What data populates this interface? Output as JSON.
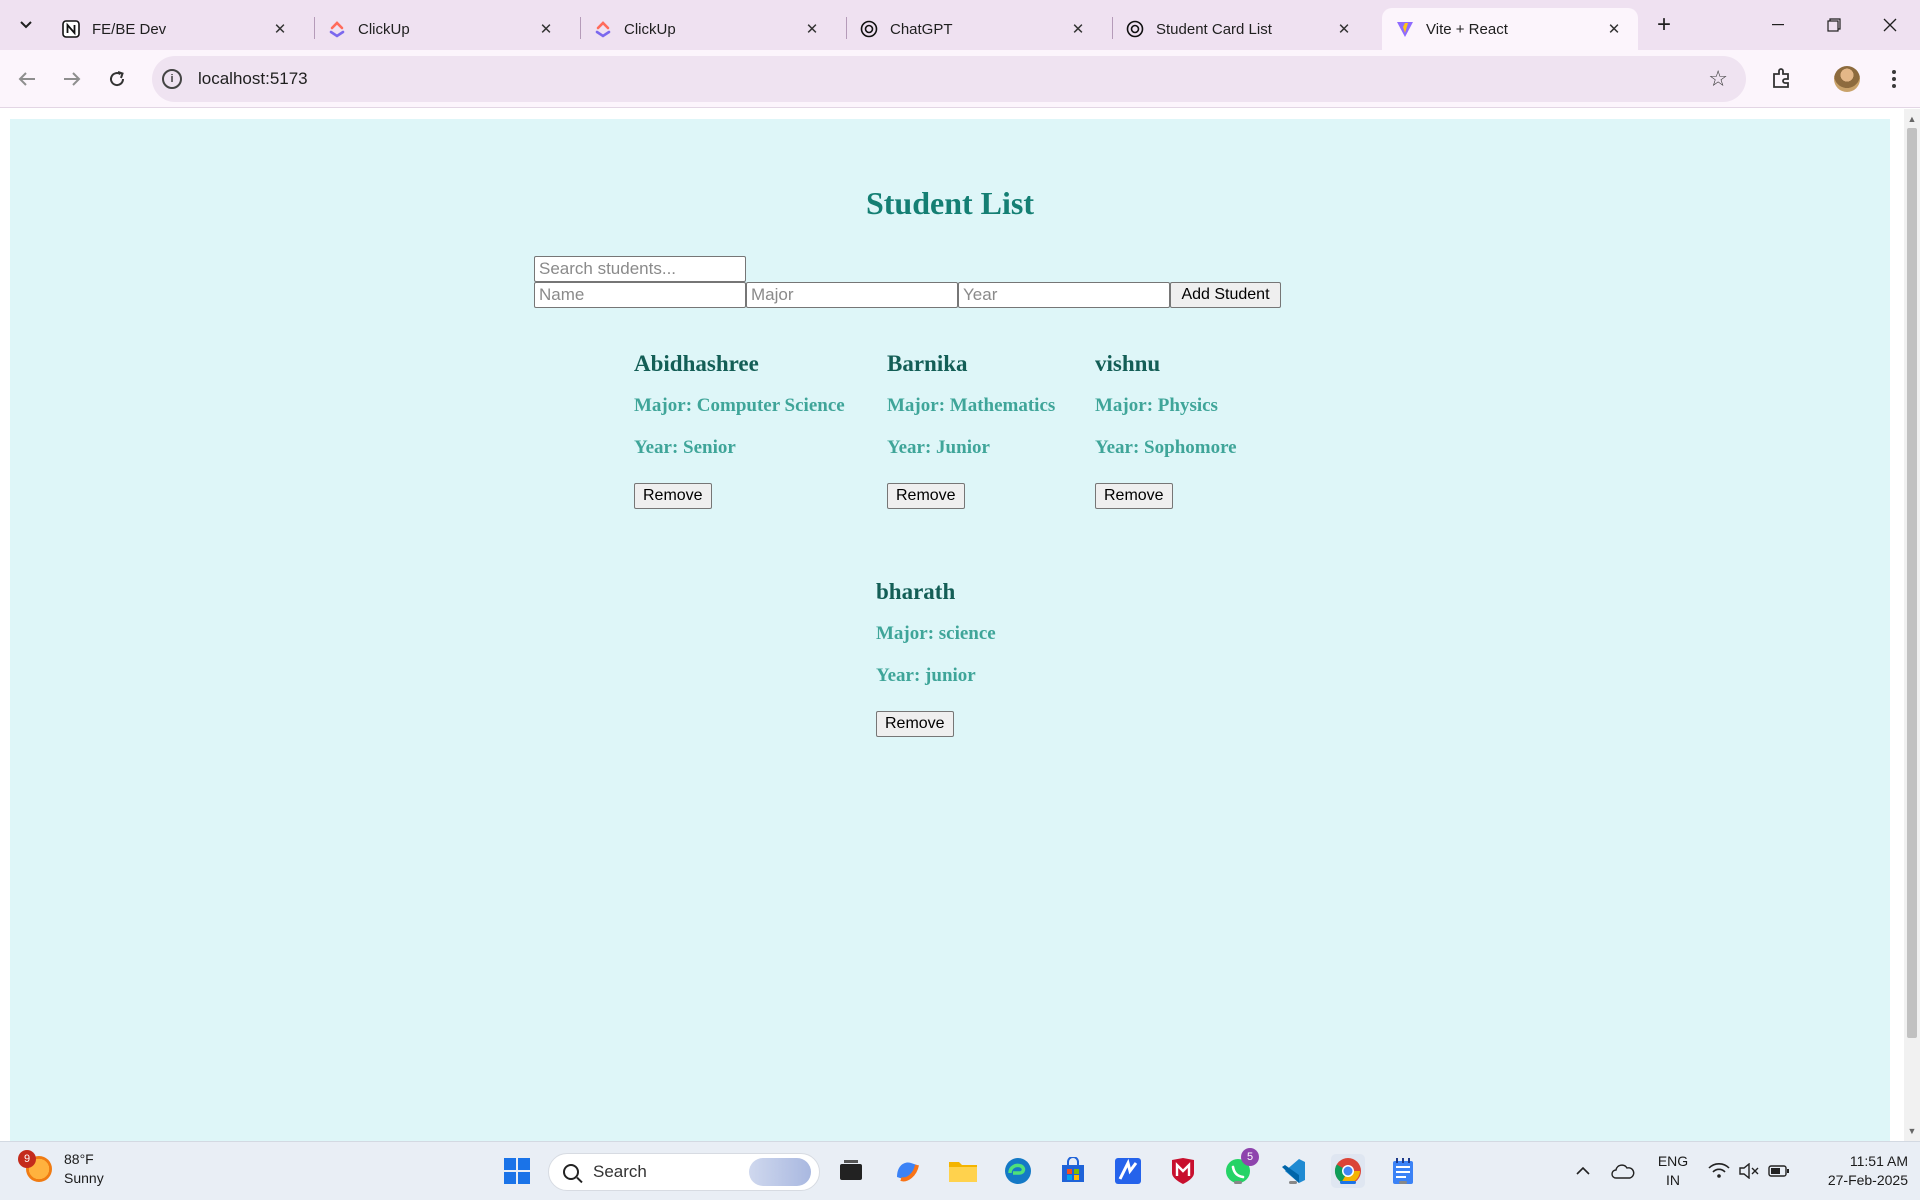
{
  "browser": {
    "tabs": [
      {
        "title": "FE/BE Dev",
        "favicon": "notion-icon"
      },
      {
        "title": "ClickUp",
        "favicon": "clickup-icon"
      },
      {
        "title": "ClickUp",
        "favicon": "clickup-icon"
      },
      {
        "title": "ChatGPT",
        "favicon": "chatgpt-icon"
      },
      {
        "title": "Student Card List",
        "favicon": "chatgpt-icon"
      },
      {
        "title": "Vite + React",
        "favicon": "vite-icon",
        "active": true
      }
    ],
    "url": "localhost:5173"
  },
  "app": {
    "title": "Student List",
    "search_placeholder": "Search students...",
    "name_placeholder": "Name",
    "major_placeholder": "Major",
    "year_placeholder": "Year",
    "add_label": "Add Student",
    "remove_label": "Remove",
    "students": [
      {
        "name": "Abidhashree",
        "major": "Major: Computer Science",
        "year": "Year: Senior"
      },
      {
        "name": "Barnika",
        "major": "Major: Mathematics",
        "year": "Year: Junior"
      },
      {
        "name": "vishnu",
        "major": "Major: Physics",
        "year": "Year: Sophomore"
      },
      {
        "name": "bharath",
        "major": "Major: science",
        "year": "Year: junior"
      }
    ]
  },
  "taskbar": {
    "weather": {
      "temp": "88°F",
      "condition": "Sunny",
      "badge": "9"
    },
    "search_label": "Search",
    "whatsapp_badge": "5",
    "lang_top": "ENG",
    "lang_bottom": "IN",
    "time": "11:51 AM",
    "date": "27-Feb-2025"
  },
  "colors": {
    "page_bg": "#def6f8",
    "title": "#147f73",
    "student_name": "#135e56",
    "student_detail": "#3fa599"
  }
}
